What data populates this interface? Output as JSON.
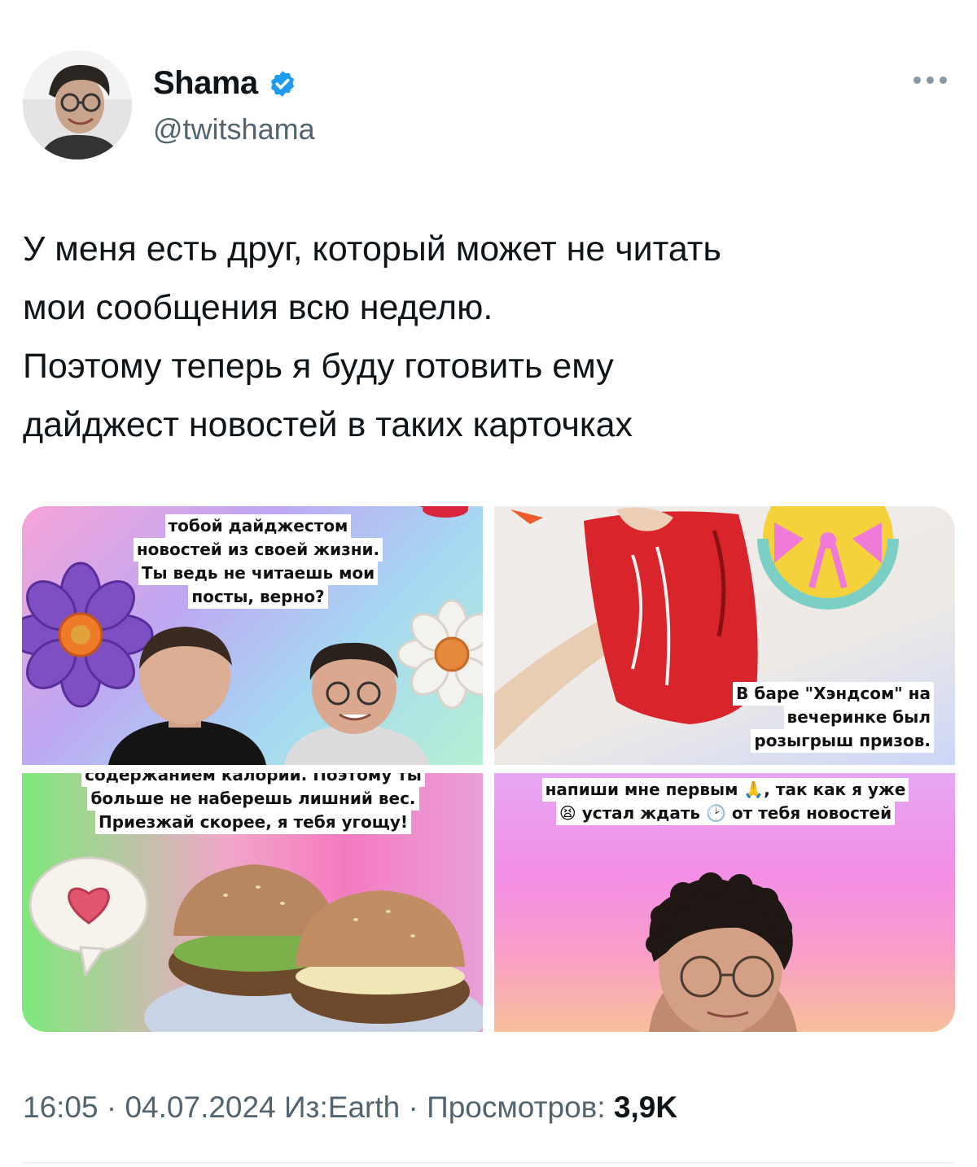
{
  "author": {
    "display_name": "Shama",
    "handle": "@twitshama",
    "verified_icon": "verified-badge-icon",
    "more_icon": "more-options-icon"
  },
  "tweet": {
    "lines": [
      "У меня есть друг, который может не читать",
      "мои сообщения всю неделю.",
      "Поэтому теперь я буду готовить ему",
      "дайджест новостей в таких карточках"
    ]
  },
  "media": {
    "card1": {
      "lines": [
        "тобой дайджестом",
        "новостей из своей жизни.",
        "Ты ведь не читаешь мои",
        "посты, верно?"
      ]
    },
    "card2": {
      "lines": [
        "В баре \"Хэндсом\" на",
        "вечеринке был",
        "розыгрыш призов."
      ]
    },
    "card3": {
      "lines": [
        "содержанием калорий. Поэтому ты",
        "больше не наберешь лишний вес.",
        "Приезжай скорее, я тебя угощу!"
      ]
    },
    "card4": {
      "lines": [
        "напиши мне первым 🙏, так как я уже",
        "😫 устал ждать 🕑 от тебя новостей"
      ]
    }
  },
  "meta": {
    "time": "16:05",
    "date": "04.07.2024",
    "source": "Из:Earth",
    "views_label": "Просмотров:",
    "views_count": "3,9K"
  },
  "colors": {
    "text_primary": "#0f1419",
    "text_secondary": "#536471",
    "verified_blue": "#1d9bf0"
  }
}
